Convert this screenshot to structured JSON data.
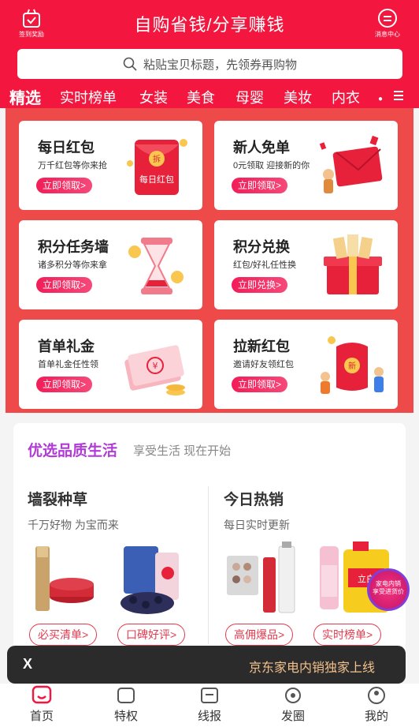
{
  "colors": {
    "brand_red": "#f3173f",
    "promo_bg": "#ee4a4a",
    "accent_purple": "#b13bd6"
  },
  "header": {
    "title": "自购省钱/分享赚钱",
    "left_button": {
      "icon": "checkin-bag-icon",
      "label": "签到奖励"
    },
    "right_button": {
      "icon": "message-icon",
      "label": "消息中心"
    }
  },
  "search": {
    "placeholder": "粘贴宝贝标题，先领券再购物",
    "icon": "search-icon"
  },
  "tabs": [
    {
      "label": "精选",
      "active": true
    },
    {
      "label": "实时榜单"
    },
    {
      "label": "女装"
    },
    {
      "label": "美食"
    },
    {
      "label": "母婴"
    },
    {
      "label": "美妆"
    },
    {
      "label": "内衣"
    }
  ],
  "promo_cards": [
    {
      "title": "每日红包",
      "subtitle": "万千红包等你来抢",
      "cta": "立即领取>",
      "art_text": "每日红包",
      "art_icon": "red-envelope-icon"
    },
    {
      "title": "新人免单",
      "subtitle": "0元领取 迎接新的你",
      "cta": "立即领取>",
      "art_icon": "gift-envelope-icon"
    },
    {
      "title": "积分任务墙",
      "subtitle": "诸多积分等你来拿",
      "cta": "立即领取>",
      "art_icon": "hourglass-coins-icon"
    },
    {
      "title": "积分兑换",
      "subtitle": "红包/好礼任性换",
      "cta": "立即兑换>",
      "art_icon": "gift-box-icon"
    },
    {
      "title": "首单礼金",
      "subtitle": "首单礼金任性领",
      "cta": "立即领取>",
      "art_icon": "cash-stack-icon"
    },
    {
      "title": "拉新红包",
      "subtitle": "邀请好友领红包",
      "cta": "立即领取>",
      "art_icon": "invite-envelope-icon"
    }
  ],
  "quality": {
    "title": "优选品质生活",
    "subtitle": "享受生活 现在开始",
    "left": {
      "heading": "墙裂种草",
      "desc": "千万好物 为宝而来",
      "pills": [
        "必买清单>",
        "口碑好评>"
      ]
    },
    "right": {
      "heading": "今日热销",
      "desc": "每日实时更新",
      "pills": [
        "高佣爆品>",
        "实时榜单>"
      ]
    }
  },
  "float_badge": {
    "line1": "家电内销",
    "line2": "享受进货价"
  },
  "toast": {
    "close": "X",
    "message": "京东家电内销独家上线"
  },
  "bottom_nav": [
    {
      "label": "首页",
      "icon": "home-icon",
      "active": true
    },
    {
      "label": "特权",
      "icon": "privilege-icon"
    },
    {
      "label": "线报",
      "icon": "news-icon"
    },
    {
      "label": "发圈",
      "icon": "share-circle-icon"
    },
    {
      "label": "我的",
      "icon": "profile-icon"
    }
  ]
}
